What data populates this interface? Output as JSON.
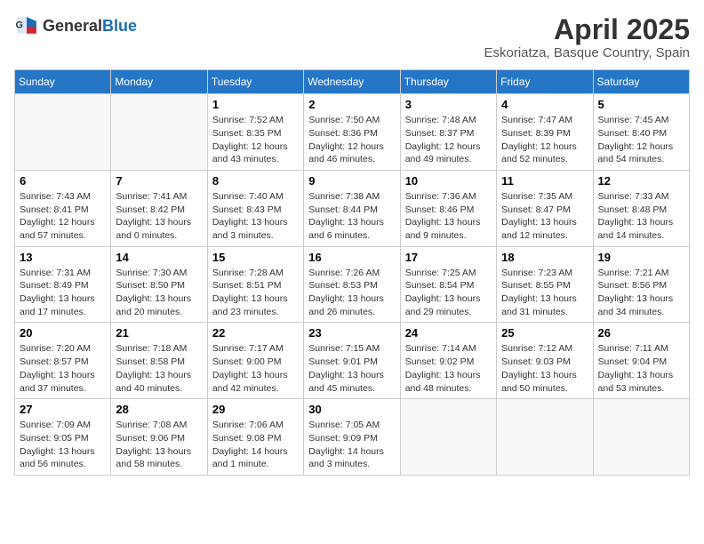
{
  "header": {
    "logo_general": "General",
    "logo_blue": "Blue",
    "month_title": "April 2025",
    "location": "Eskoriatza, Basque Country, Spain"
  },
  "weekdays": [
    "Sunday",
    "Monday",
    "Tuesday",
    "Wednesday",
    "Thursday",
    "Friday",
    "Saturday"
  ],
  "weeks": [
    [
      {
        "day": "",
        "info": ""
      },
      {
        "day": "",
        "info": ""
      },
      {
        "day": "1",
        "info": "Sunrise: 7:52 AM\nSunset: 8:35 PM\nDaylight: 12 hours and 43 minutes."
      },
      {
        "day": "2",
        "info": "Sunrise: 7:50 AM\nSunset: 8:36 PM\nDaylight: 12 hours and 46 minutes."
      },
      {
        "day": "3",
        "info": "Sunrise: 7:48 AM\nSunset: 8:37 PM\nDaylight: 12 hours and 49 minutes."
      },
      {
        "day": "4",
        "info": "Sunrise: 7:47 AM\nSunset: 8:39 PM\nDaylight: 12 hours and 52 minutes."
      },
      {
        "day": "5",
        "info": "Sunrise: 7:45 AM\nSunset: 8:40 PM\nDaylight: 12 hours and 54 minutes."
      }
    ],
    [
      {
        "day": "6",
        "info": "Sunrise: 7:43 AM\nSunset: 8:41 PM\nDaylight: 12 hours and 57 minutes."
      },
      {
        "day": "7",
        "info": "Sunrise: 7:41 AM\nSunset: 8:42 PM\nDaylight: 13 hours and 0 minutes."
      },
      {
        "day": "8",
        "info": "Sunrise: 7:40 AM\nSunset: 8:43 PM\nDaylight: 13 hours and 3 minutes."
      },
      {
        "day": "9",
        "info": "Sunrise: 7:38 AM\nSunset: 8:44 PM\nDaylight: 13 hours and 6 minutes."
      },
      {
        "day": "10",
        "info": "Sunrise: 7:36 AM\nSunset: 8:46 PM\nDaylight: 13 hours and 9 minutes."
      },
      {
        "day": "11",
        "info": "Sunrise: 7:35 AM\nSunset: 8:47 PM\nDaylight: 13 hours and 12 minutes."
      },
      {
        "day": "12",
        "info": "Sunrise: 7:33 AM\nSunset: 8:48 PM\nDaylight: 13 hours and 14 minutes."
      }
    ],
    [
      {
        "day": "13",
        "info": "Sunrise: 7:31 AM\nSunset: 8:49 PM\nDaylight: 13 hours and 17 minutes."
      },
      {
        "day": "14",
        "info": "Sunrise: 7:30 AM\nSunset: 8:50 PM\nDaylight: 13 hours and 20 minutes."
      },
      {
        "day": "15",
        "info": "Sunrise: 7:28 AM\nSunset: 8:51 PM\nDaylight: 13 hours and 23 minutes."
      },
      {
        "day": "16",
        "info": "Sunrise: 7:26 AM\nSunset: 8:53 PM\nDaylight: 13 hours and 26 minutes."
      },
      {
        "day": "17",
        "info": "Sunrise: 7:25 AM\nSunset: 8:54 PM\nDaylight: 13 hours and 29 minutes."
      },
      {
        "day": "18",
        "info": "Sunrise: 7:23 AM\nSunset: 8:55 PM\nDaylight: 13 hours and 31 minutes."
      },
      {
        "day": "19",
        "info": "Sunrise: 7:21 AM\nSunset: 8:56 PM\nDaylight: 13 hours and 34 minutes."
      }
    ],
    [
      {
        "day": "20",
        "info": "Sunrise: 7:20 AM\nSunset: 8:57 PM\nDaylight: 13 hours and 37 minutes."
      },
      {
        "day": "21",
        "info": "Sunrise: 7:18 AM\nSunset: 8:58 PM\nDaylight: 13 hours and 40 minutes."
      },
      {
        "day": "22",
        "info": "Sunrise: 7:17 AM\nSunset: 9:00 PM\nDaylight: 13 hours and 42 minutes."
      },
      {
        "day": "23",
        "info": "Sunrise: 7:15 AM\nSunset: 9:01 PM\nDaylight: 13 hours and 45 minutes."
      },
      {
        "day": "24",
        "info": "Sunrise: 7:14 AM\nSunset: 9:02 PM\nDaylight: 13 hours and 48 minutes."
      },
      {
        "day": "25",
        "info": "Sunrise: 7:12 AM\nSunset: 9:03 PM\nDaylight: 13 hours and 50 minutes."
      },
      {
        "day": "26",
        "info": "Sunrise: 7:11 AM\nSunset: 9:04 PM\nDaylight: 13 hours and 53 minutes."
      }
    ],
    [
      {
        "day": "27",
        "info": "Sunrise: 7:09 AM\nSunset: 9:05 PM\nDaylight: 13 hours and 56 minutes."
      },
      {
        "day": "28",
        "info": "Sunrise: 7:08 AM\nSunset: 9:06 PM\nDaylight: 13 hours and 58 minutes."
      },
      {
        "day": "29",
        "info": "Sunrise: 7:06 AM\nSunset: 9:08 PM\nDaylight: 14 hours and 1 minute."
      },
      {
        "day": "30",
        "info": "Sunrise: 7:05 AM\nSunset: 9:09 PM\nDaylight: 14 hours and 3 minutes."
      },
      {
        "day": "",
        "info": ""
      },
      {
        "day": "",
        "info": ""
      },
      {
        "day": "",
        "info": ""
      }
    ]
  ]
}
